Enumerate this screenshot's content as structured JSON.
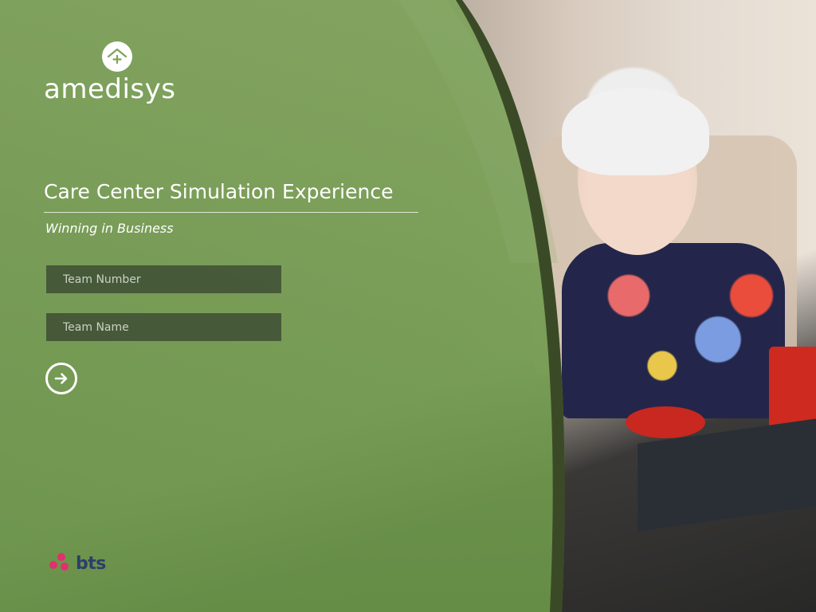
{
  "brand": {
    "name": "amedisys",
    "icon": "house-plus-icon"
  },
  "header": {
    "title": "Care Center Simulation Experience",
    "subtitle": "Winning in Business"
  },
  "form": {
    "team_number_placeholder": "Team Number",
    "team_number_value": "",
    "team_name_placeholder": "Team Name",
    "team_name_value": "",
    "submit_icon": "arrow-right-circle-icon"
  },
  "footer": {
    "partner_logo_text": "bts"
  },
  "colors": {
    "overlay_green": "#6f9a4e",
    "curve_dark_green": "#3b4a26",
    "bts_pink": "#e0306e",
    "bts_navy": "#2b3f6b",
    "text": "#ffffff"
  }
}
